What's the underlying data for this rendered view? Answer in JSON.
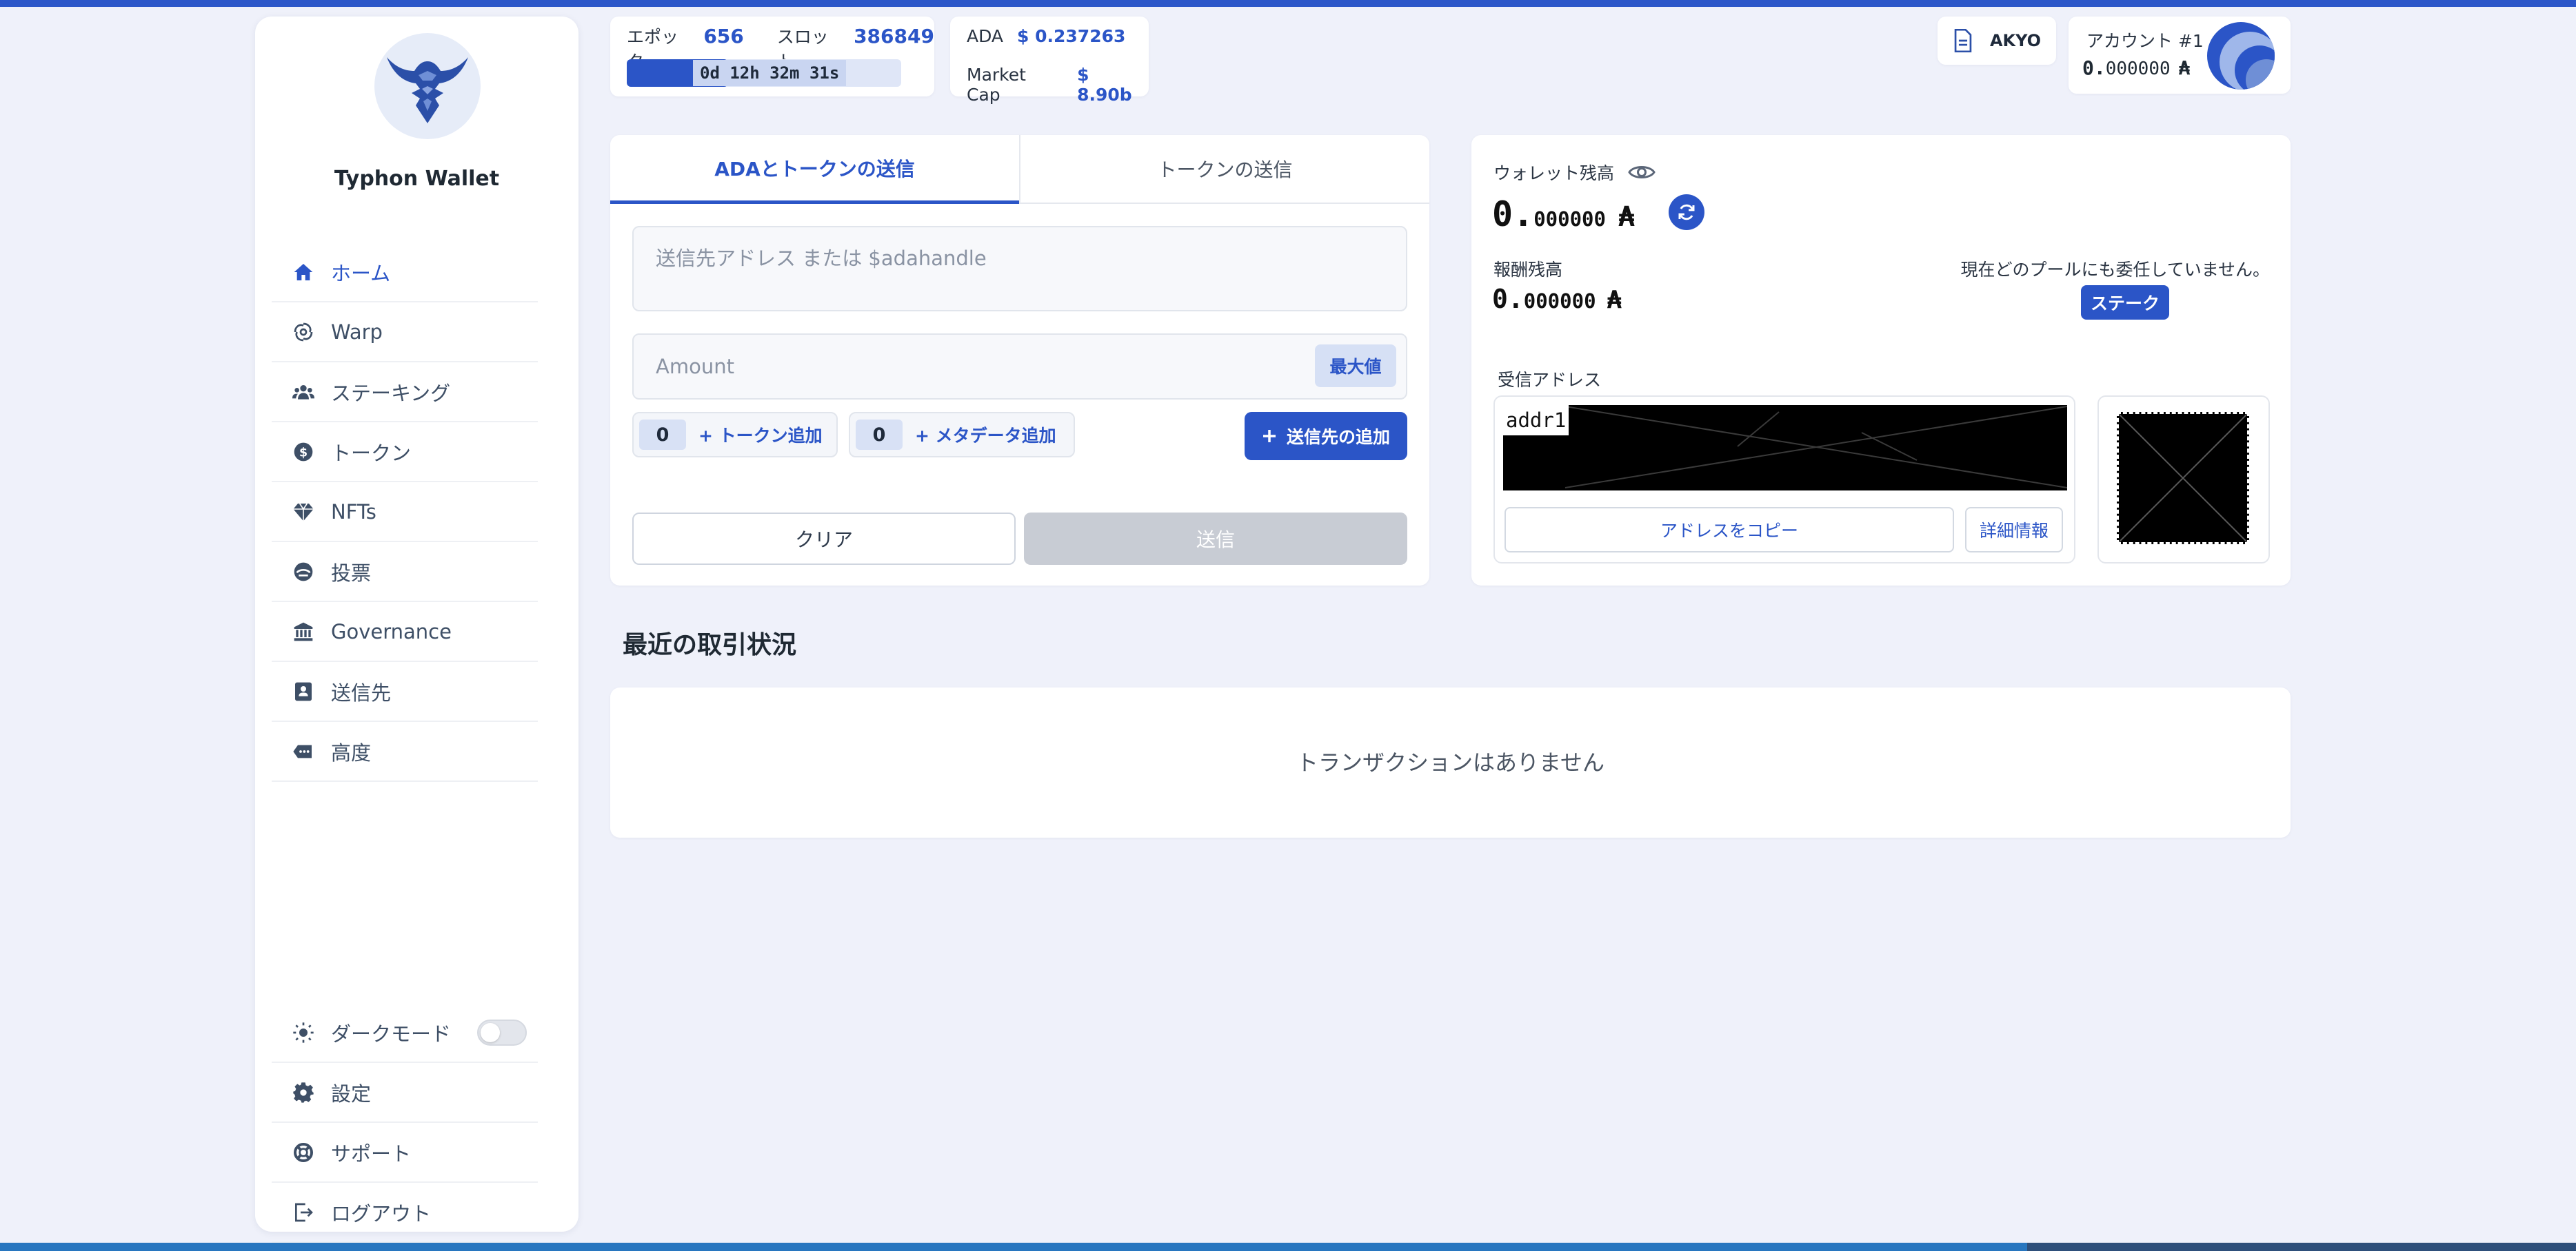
{
  "app": {
    "name": "Typhon Wallet"
  },
  "sidebar": {
    "items": [
      {
        "label": "ホーム",
        "icon": "home-icon",
        "active": true
      },
      {
        "label": "Warp",
        "icon": "warp-icon"
      },
      {
        "label": "ステーキング",
        "icon": "users-icon"
      },
      {
        "label": "トークン",
        "icon": "coin-icon"
      },
      {
        "label": "NFTs",
        "icon": "diamond-icon"
      },
      {
        "label": "投票",
        "icon": "vote-icon"
      },
      {
        "label": "Governance",
        "icon": "bank-icon"
      },
      {
        "label": "送信先",
        "icon": "contacts-icon"
      },
      {
        "label": "高度",
        "icon": "advanced-icon"
      }
    ],
    "bottom_items": [
      {
        "label": "ダークモード",
        "icon": "sun-icon",
        "toggle": false
      },
      {
        "label": "設定",
        "icon": "gear-icon"
      },
      {
        "label": "サポート",
        "icon": "lifebuoy-icon"
      },
      {
        "label": "ログアウト",
        "icon": "logout-icon"
      }
    ]
  },
  "header": {
    "epoch_label": "エポック",
    "epoch_value": "656",
    "slot_label": "スロット",
    "slot_value": "386849",
    "epoch_remaining": "0d 12h 32m 31s",
    "epoch_progress": 0.37,
    "ada_label": "ADA",
    "ada_price": "$ 0.237263",
    "marketcap_label": "Market Cap",
    "marketcap_value": "$ 8.90b",
    "wallet_tag": "AKYO",
    "account_label": "アカウント #1",
    "account_balance_int": "0.",
    "account_balance_dec": "000000",
    "currency_symbol": "₳"
  },
  "send": {
    "tabs": [
      "ADAとトークンの送信",
      "トークンの送信"
    ],
    "address_placeholder": "送信先アドレス または $adahandle",
    "amount_placeholder": "Amount",
    "max_label": "最大値",
    "token_count": "0",
    "add_token_label": "+ トークン追加",
    "metadata_count": "0",
    "add_metadata_label": "+ メタデータ追加",
    "add_recipient_label": "送信先の追加",
    "clear_label": "クリア",
    "send_label": "送信"
  },
  "wallet": {
    "balance_label": "ウォレット残高",
    "balance_int": "0.",
    "balance_dec": "000000",
    "reward_label": "報酬残高",
    "reward_int": "0.",
    "reward_dec": "000000",
    "delegation_status": "現在どのプールにも委任していません。",
    "stake_label": "ステーク",
    "receive_label": "受信アドレス",
    "address_prefix": "addr1",
    "copy_label": "アドレスをコピー",
    "details_label": "詳細情報"
  },
  "transactions": {
    "title": "最近の取引状況",
    "empty_message": "トランザクションはありません"
  },
  "colors": {
    "accent": "#2b55c7",
    "background": "#eff1fa",
    "topbar": "#2c57c9"
  }
}
